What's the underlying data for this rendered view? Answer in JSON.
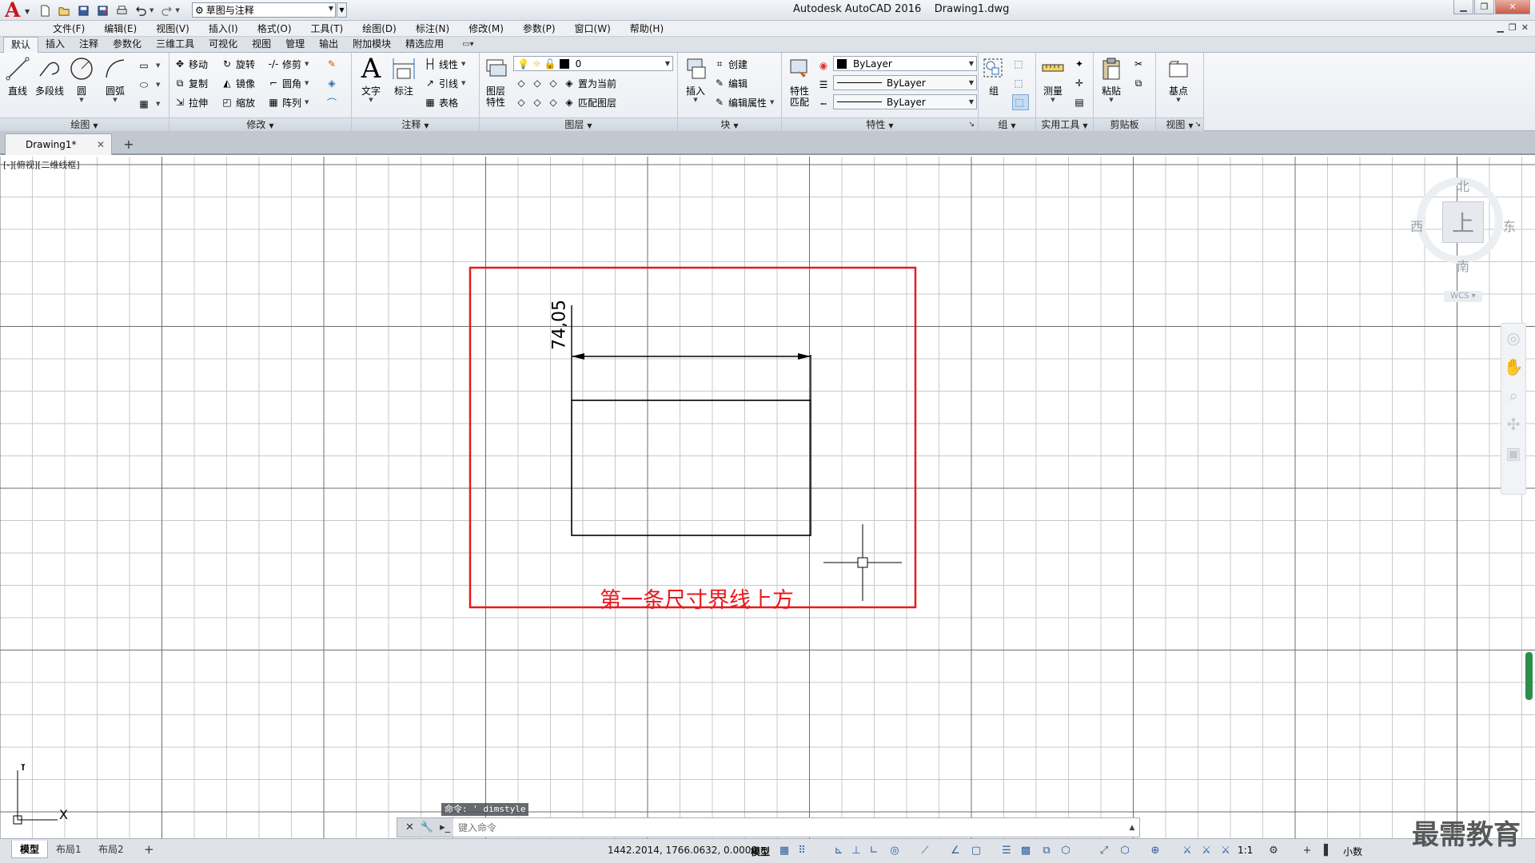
{
  "titlebar": {
    "workspace": "草图与注释",
    "app_title": "Autodesk AutoCAD 2016    Drawing1.dwg"
  },
  "menubar": [
    "文件(F)",
    "编辑(E)",
    "视图(V)",
    "插入(I)",
    "格式(O)",
    "工具(T)",
    "绘图(D)",
    "标注(N)",
    "修改(M)",
    "参数(P)",
    "窗口(W)",
    "帮助(H)"
  ],
  "ribbon_tabs": [
    "默认",
    "插入",
    "注释",
    "参数化",
    "三维工具",
    "可视化",
    "视图",
    "管理",
    "输出",
    "附加模块",
    "精选应用"
  ],
  "ribbon": {
    "draw": {
      "title": "绘图",
      "line": "直线",
      "polyline": "多段线",
      "circle": "圆",
      "arc": "圆弧"
    },
    "modify": {
      "title": "修改",
      "move": "移动",
      "rotate": "旋转",
      "trim": "修剪",
      "copy": "复制",
      "mirror": "镜像",
      "fillet": "圆角",
      "stretch": "拉伸",
      "scale": "缩放",
      "array": "阵列"
    },
    "annotation": {
      "title": "注释",
      "text": "文字",
      "dimension": "标注",
      "linear": "线性",
      "leader": "引线",
      "table": "表格"
    },
    "layers": {
      "title": "图层",
      "properties_a": "图层",
      "properties_b": "特性",
      "current_layer": "0",
      "set_current": "置为当前",
      "match_layer": "匹配图层"
    },
    "block": {
      "title": "块",
      "insert": "插入",
      "create": "创建",
      "edit": "编辑",
      "edit_attr": "编辑属性"
    },
    "properties": {
      "title": "特性",
      "match_a": "特性",
      "match_b": "匹配",
      "color": "ByLayer",
      "linetype": "ByLayer",
      "lineweight": "ByLayer"
    },
    "groups": {
      "title": "组",
      "group": "组"
    },
    "utilities": {
      "title": "实用工具",
      "measure": "测量"
    },
    "clipboard": {
      "title": "剪贴板",
      "paste": "粘贴"
    },
    "view": {
      "title": "视图",
      "base": "基点"
    }
  },
  "file_tab": {
    "name": "Drawing1*"
  },
  "viewport_label": "[-][俯视][二维线框]",
  "drawing": {
    "dimension_value": "74,05",
    "annotation": "第一条尺寸界线上方"
  },
  "viewcube": {
    "north": "北",
    "south": "南",
    "west": "西",
    "east": "东",
    "wcs": "WCS ▾"
  },
  "ucs": {
    "x": "X",
    "y": "Y"
  },
  "command": {
    "history": "命令: ' dimstyle",
    "placeholder": "键入命令"
  },
  "layout_tabs": [
    "模型",
    "布局1",
    "布局2"
  ],
  "statusbar": {
    "coords": "1442.2014, 1766.0632, 0.0000",
    "model": "模型",
    "scale": "1:1",
    "units": "小数"
  },
  "watermark": "最需教育",
  "colors": {
    "annotation_red": "#e8191d",
    "grid": "#5a5a5a"
  }
}
